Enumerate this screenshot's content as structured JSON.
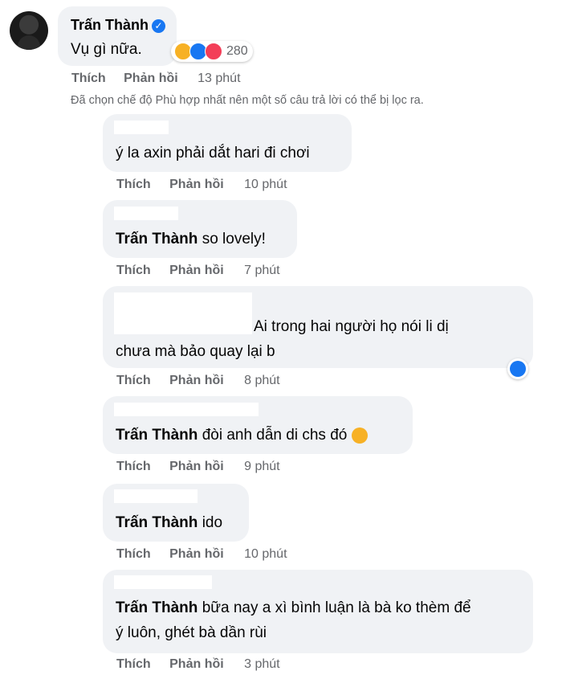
{
  "comment": {
    "author": "Trấn Thành",
    "text": "Vụ gì nữa.",
    "reaction_count": "280",
    "reactions": [
      "haha-icon",
      "like-icon",
      "love-icon"
    ],
    "like_label": "Thích",
    "reply_label": "Phản hồi",
    "time": "13 phút"
  },
  "filter_notice": "Đã chọn chế độ Phù hợp nhất nên một số câu trả lời có thể bị lọc ra.",
  "replies": [
    {
      "mention": "",
      "text": "ý la axin phải dắt hari đi chơi",
      "like_label": "Thích",
      "reply_label": "Phản hồi",
      "time": "10 phút"
    },
    {
      "mention": "Trấn Thành",
      "text": "so lovely!",
      "like_label": "Thích",
      "reply_label": "Phản hồi",
      "time": "7 phút"
    },
    {
      "mention": "",
      "text_line1": "Ai trong hai người họ nói li dị",
      "text_line2": "chưa mà bảo quay lại b",
      "like_label": "Thích",
      "reply_label": "Phản hồi",
      "time": "8 phút"
    },
    {
      "mention": "Trấn Thành",
      "text": "đòi anh dẫn di chs đó",
      "like_label": "Thích",
      "reply_label": "Phản hồi",
      "time": "9 phút"
    },
    {
      "mention": "Trấn Thành",
      "text": "ido",
      "like_label": "Thích",
      "reply_label": "Phản hồi",
      "time": "10 phút"
    },
    {
      "mention": "Trấn Thành",
      "text_line1": "bữa nay a xì bình luận là bà ko thèm để",
      "text_line2": "ý luôn, ghét bà dần rùi",
      "like_label": "Thích",
      "reply_label": "Phản hồi",
      "time": "3 phút"
    }
  ],
  "colors": {
    "bubble": "#f0f2f5",
    "meta": "#65676b",
    "verified": "#1877f2"
  }
}
